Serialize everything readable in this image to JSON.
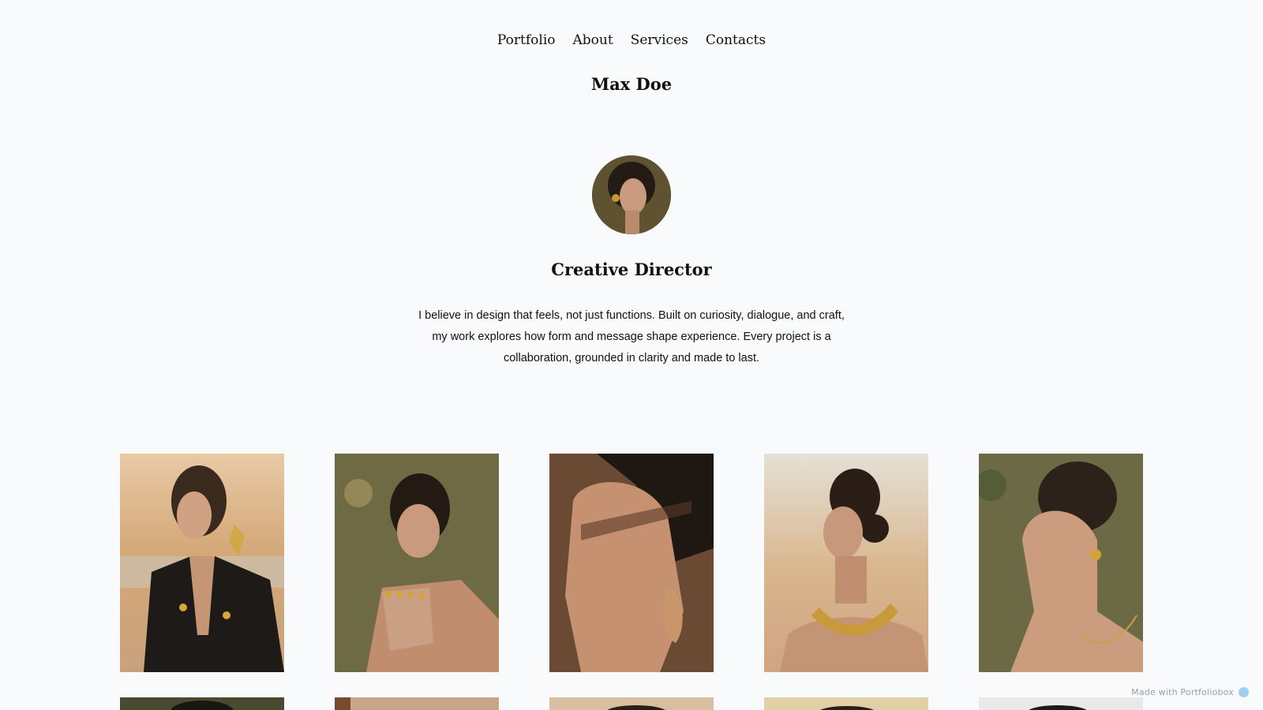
{
  "nav": {
    "items": [
      {
        "label": "Portfolio"
      },
      {
        "label": "About"
      },
      {
        "label": "Services"
      },
      {
        "label": "Contacts"
      }
    ]
  },
  "site": {
    "title": "Max Doe"
  },
  "profile": {
    "role": "Creative Director",
    "bio": "I believe in design that feels, not just functions. Built on curiosity, dialogue, and craft, my work explores how form and message shape experience. Every project is a collaboration, grounded in clarity and made to last."
  },
  "gallery": {
    "row1": [
      {
        "name": "portfolio-photo-beach-blazer"
      },
      {
        "name": "portfolio-photo-rings-olive"
      },
      {
        "name": "portfolio-photo-shadow-profile"
      },
      {
        "name": "portfolio-photo-gold-necklace"
      },
      {
        "name": "portfolio-photo-earring-profile"
      }
    ]
  },
  "footer": {
    "badge_label": "Made with Portfoliobox"
  },
  "colors": {
    "background": "#f9fafc",
    "text": "#111111",
    "badge_text": "#9a9ea6",
    "badge_accent": "#9fd0ef"
  }
}
